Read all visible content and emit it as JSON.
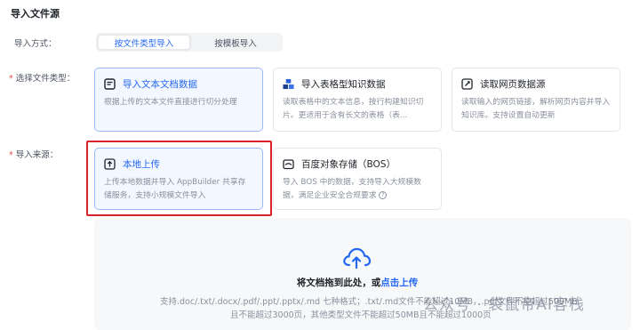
{
  "section_title": "导入文件源",
  "import_method": {
    "label": "导入方式：",
    "options": [
      "按文件类型导入",
      "按模板导入"
    ],
    "selected": "按文件类型导入"
  },
  "file_type": {
    "label": "选择文件类型：",
    "required_mark": "*",
    "cards": [
      {
        "title": "导入文本文档数据",
        "desc": "根据上传的文本文件直接进行切分处理",
        "icon": "document-icon",
        "selected": true
      },
      {
        "title": "导入表格型知识数据",
        "desc": "读取表格中的文本信息，按行构建知识切片。更适用于含有长文的表格（表...",
        "icon": "table-cubes-icon",
        "selected": false
      },
      {
        "title": "读取网页数据源",
        "desc": "读取输入的网页链接，解析网页内容并导入知识库。支持设置自动更新",
        "icon": "link-icon",
        "selected": false
      }
    ]
  },
  "source": {
    "label": "导入来源：",
    "required_mark": "*",
    "cards": [
      {
        "title": "本地上传",
        "desc": "上传本地数据并导入 AppBuilder 共享存储服务，支持小规模文件导入",
        "icon": "upload-icon",
        "selected": true
      },
      {
        "title": "百度对象存储（BOS）",
        "desc": "导入 BOS 中的数据，支持导入大规模数据，满足企业安全合规要求",
        "icon": "bos-icon",
        "selected": false
      }
    ]
  },
  "upload": {
    "text_prefix": "将文档拖到此处，或",
    "link": "点击上传",
    "hint_line1": "支持.doc/.txt/.docx/.pdf/.ppt/.pptx/.md 七种格式；.txt/.md文件不能超过10MB，.pdf文件不能超过500MB",
    "hint_line2": "且不能超过3000页，其他类型文件不能超过50MB且不能超过1000页"
  },
  "watermark": "公众号 · 袋鼠帝AI客栈",
  "colors": {
    "accent": "#2468f2",
    "highlight": "#d9222a",
    "required": "#e24c4c"
  }
}
